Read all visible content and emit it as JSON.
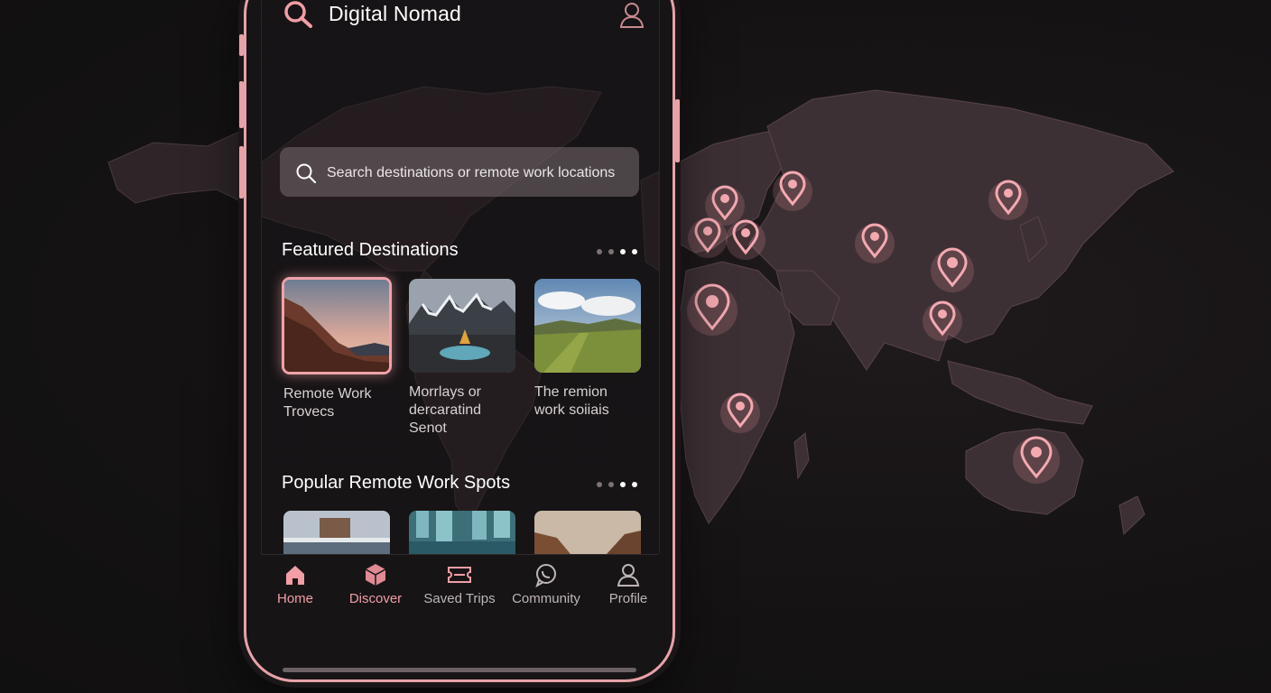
{
  "app": {
    "title": "Digital Nomad",
    "search_icon": "search-icon",
    "profile_icon": "user-icon"
  },
  "search": {
    "placeholder": "Search destinations or remote work locations"
  },
  "featured": {
    "title": "Featured Destinations",
    "page_dots": 4,
    "active_dots": [
      2,
      3
    ],
    "cards": [
      {
        "caption": "Remote Work\nTrovecs",
        "selected": true
      },
      {
        "caption": "Morrlays or\ndercaratind\nSenot",
        "selected": false
      },
      {
        "caption": "The remion\nwork soiiais",
        "selected": false
      }
    ]
  },
  "popular": {
    "title": "Popular Remote Work Spots",
    "page_dots": 4,
    "active_dots": [
      2,
      3
    ]
  },
  "nav": {
    "items": [
      {
        "label": "Home",
        "icon": "home-icon",
        "active": true
      },
      {
        "label": "Discover",
        "icon": "cube-icon",
        "active": true
      },
      {
        "label": "Saved Trips",
        "icon": "ticket-icon",
        "active": false
      },
      {
        "label": "Community",
        "icon": "chat-icon",
        "active": false
      },
      {
        "label": "Profile",
        "icon": "user-icon",
        "active": false
      }
    ]
  },
  "colors": {
    "accent": "#f19ea6",
    "background": "#141213",
    "land": "#3d3034"
  }
}
